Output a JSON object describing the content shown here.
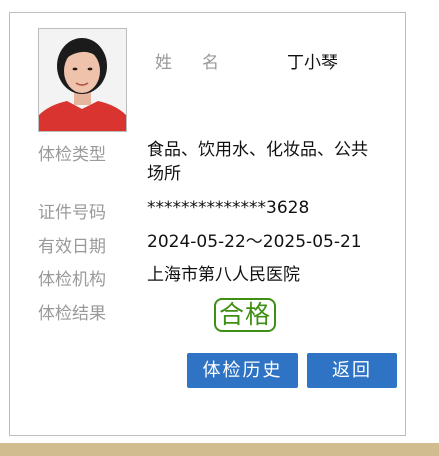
{
  "profile": {
    "name_label": "姓名",
    "name_value": "丁小琴"
  },
  "fields": [
    {
      "label": "体检类型",
      "value": "食品、饮用水、化妆品、公共场所"
    },
    {
      "label": "证件号码",
      "value": "**************3628"
    },
    {
      "label": "有效日期",
      "value": "2024-05-22～2025-05-21"
    },
    {
      "label": "体检机构",
      "value": "上海市第八人民医院"
    },
    {
      "label": "体检结果",
      "value": ""
    }
  ],
  "result": {
    "text": "合格",
    "color": "#3f8f14"
  },
  "buttons": {
    "history": "体检历史",
    "back": "返回"
  },
  "colors": {
    "button": "#2f73c4",
    "label": "#9a9a9a",
    "strip": "#d0bc8e"
  }
}
